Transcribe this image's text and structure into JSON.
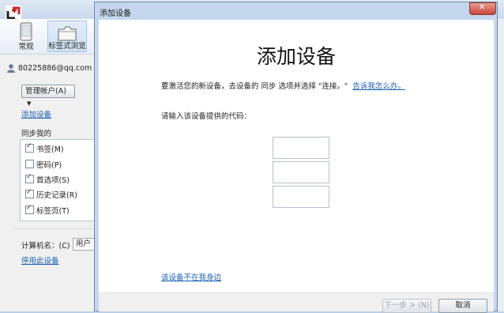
{
  "options_window": {
    "toolbar": [
      {
        "label": "常规",
        "icon": "phone-icon"
      },
      {
        "label": "标签式浏览",
        "icon": "tabs-icon"
      }
    ],
    "account_email": "80225886@qq.com",
    "manage_account_button": "管理帐户(A)",
    "add_device_link": "添加设备",
    "sync_heading": "同步我的",
    "sync_items": [
      {
        "label": "书签(M)",
        "checked": true
      },
      {
        "label": "密码(P)",
        "checked": false
      },
      {
        "label": "首选项(S)",
        "checked": true
      },
      {
        "label": "历史记录(R)",
        "checked": true
      },
      {
        "label": "标签页(T)",
        "checked": true
      }
    ],
    "computer_name_label": "计算机名：(C)",
    "computer_name_value": "用户",
    "disable_device_link": "停用此设备"
  },
  "dialog": {
    "title": "添加设备",
    "heading": "添加设备",
    "instructions": "要激活您的新设备，去设备的 同步 选项并选择 \"连接。\"",
    "help_link": "告诉我怎么办。",
    "code_prompt": "请输入该设备提供的代码：",
    "code_values": [
      "",
      "",
      ""
    ],
    "device_not_here_link": "该设备不在我身边",
    "next_button": "下一步 > (N)",
    "cancel_button": "取消"
  }
}
